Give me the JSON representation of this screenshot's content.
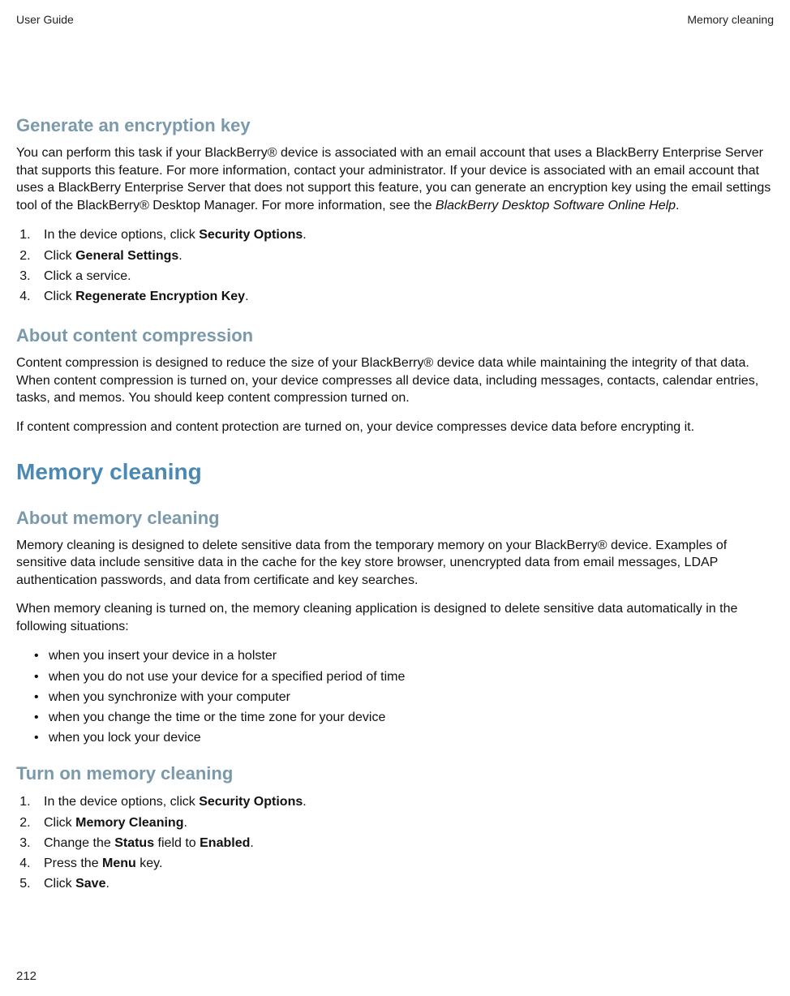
{
  "header": {
    "left": "User Guide",
    "right": "Memory cleaning"
  },
  "sections": {
    "genKey": {
      "title": "Generate an encryption key",
      "para_pre": "You can perform this task if your BlackBerry® device is associated with an email account that uses a BlackBerry Enterprise Server that supports this feature. For more information, contact your administrator. If your device is associated with an email account that uses a BlackBerry Enterprise Server that does not support this feature, you can generate an encryption key using the email settings tool of the BlackBerry® Desktop Manager. For more information, see the  ",
      "para_italic": "BlackBerry Desktop Software Online Help",
      "para_post": ".",
      "steps": {
        "s1_pre": "In the device options, click ",
        "s1_b": "Security Options",
        "s1_post": ".",
        "s2_pre": "Click ",
        "s2_b": "General Settings",
        "s2_post": ".",
        "s3": "Click a service.",
        "s4_pre": "Click ",
        "s4_b": "Regenerate Encryption Key",
        "s4_post": "."
      }
    },
    "compression": {
      "title": "About content compression",
      "p1": "Content compression is designed to reduce the size of your BlackBerry® device data while maintaining the integrity of that data. When content compression is turned on, your device compresses all device data, including messages, contacts, calendar entries, tasks, and memos. You should keep content compression turned on.",
      "p2": "If content compression and content protection are turned on, your device compresses device data before encrypting it."
    },
    "memoryHeading": "Memory cleaning",
    "aboutMem": {
      "title": "About memory cleaning",
      "p1": "Memory cleaning is designed to delete sensitive data from the temporary memory on your BlackBerry® device. Examples of sensitive data include sensitive data in the cache for the key store browser, unencrypted data from email messages, LDAP authentication passwords, and data from certificate and key searches.",
      "p2": "When memory cleaning is turned on, the memory cleaning application is designed to delete sensitive data automatically in the following situations:",
      "bullets": {
        "b1": "when you insert your device in a holster",
        "b2": "when you do not use your device for a specified period of time",
        "b3": "when you synchronize with your computer",
        "b4": "when you change the time or the time zone for your device",
        "b5": "when you lock your device"
      }
    },
    "turnOn": {
      "title": "Turn on memory cleaning",
      "steps": {
        "s1_pre": "In the device options, click ",
        "s1_b": "Security Options",
        "s1_post": ".",
        "s2_pre": "Click ",
        "s2_b": "Memory Cleaning",
        "s2_post": ".",
        "s3_pre": "Change the ",
        "s3_b1": "Status",
        "s3_mid": " field to ",
        "s3_b2": "Enabled",
        "s3_post": ".",
        "s4_pre": "Press the ",
        "s4_b": "Menu",
        "s4_post": " key.",
        "s5_pre": "Click ",
        "s5_b": "Save",
        "s5_post": "."
      }
    }
  },
  "pageNumber": "212"
}
